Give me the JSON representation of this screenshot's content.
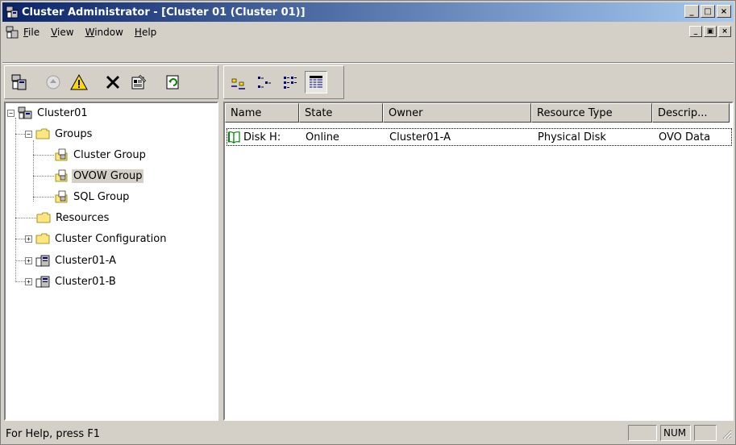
{
  "window": {
    "title": "Cluster Administrator - [Cluster 01 (Cluster 01)]",
    "minimize": "_",
    "maximize": "□",
    "close": "×"
  },
  "menu": {
    "items": [
      {
        "label": "File",
        "accel": "F",
        "rest": "ile"
      },
      {
        "label": "View",
        "accel": "V",
        "rest": "iew"
      },
      {
        "label": "Window",
        "accel": "W",
        "rest": "indow"
      },
      {
        "label": "Help",
        "accel": "H",
        "rest": "elp"
      }
    ],
    "mdi_min": "_",
    "mdi_restore": "▣",
    "mdi_close": "×"
  },
  "tree": {
    "root": "Cluster01",
    "groups": "Groups",
    "cluster_group": "Cluster Group",
    "ovow_group": "OVOW Group",
    "sql_group": "SQL Group",
    "resources": "Resources",
    "cluster_configuration": "Cluster Configuration",
    "node_a": "Cluster01-A",
    "node_b": "Cluster01-B",
    "expanded_glyph": "−",
    "collapsed_glyph": "+"
  },
  "list": {
    "columns": [
      "Name",
      "State",
      "Owner",
      "Resource Type",
      "Descrip..."
    ],
    "rows": [
      {
        "name": "Disk H:",
        "state": "Online",
        "owner": "Cluster01-A",
        "type": "Physical Disk",
        "description": "OVO Data"
      }
    ]
  },
  "status": {
    "help_text": "For Help, press F1",
    "num": "NUM"
  },
  "colors": {
    "title_start": "#0a246a",
    "title_end": "#a6caf0",
    "face": "#d4d0c8"
  }
}
